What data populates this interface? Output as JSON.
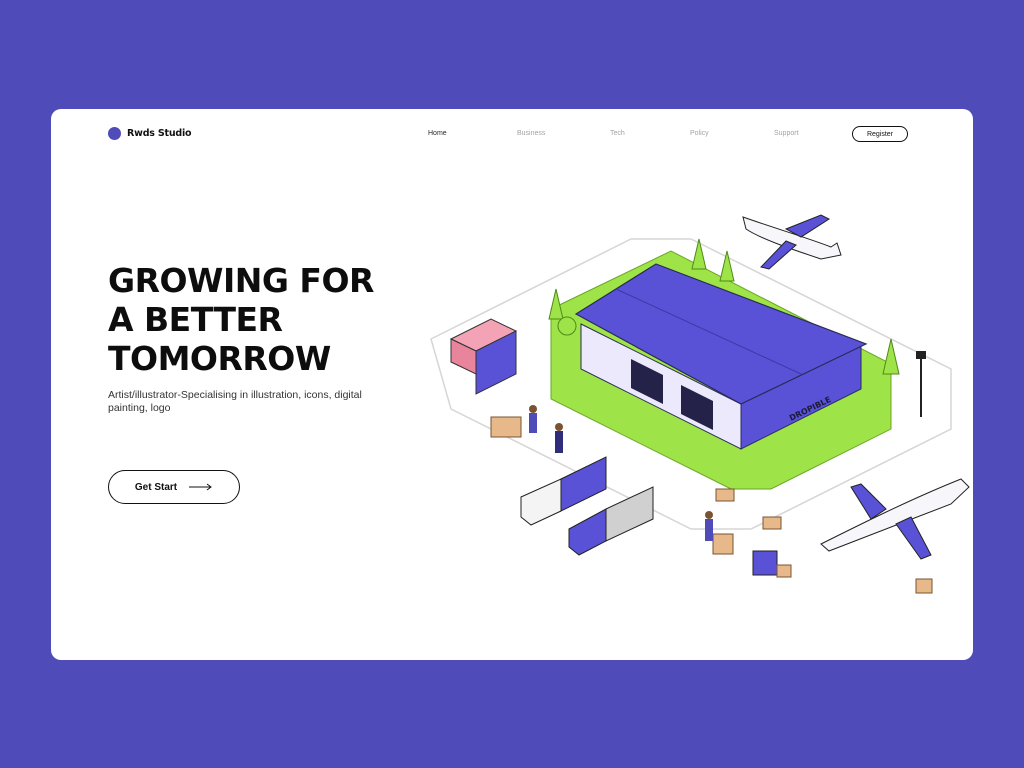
{
  "brand": {
    "name": "Rwds Studio",
    "accent": "#4f4bb8"
  },
  "nav": {
    "items": [
      {
        "label": "Home",
        "active": true
      },
      {
        "label": "Business",
        "active": false
      },
      {
        "label": "Tech",
        "active": false
      },
      {
        "label": "Policy",
        "active": false
      },
      {
        "label": "Support",
        "active": false
      }
    ],
    "register_label": "Register"
  },
  "hero": {
    "headline_lines": [
      "GROWING FOR",
      "A BETTER",
      "TOMORROW"
    ],
    "subtitle": "Artist/illustrator-Specialising in illustration, icons, digital painting, logo",
    "cta_label": "Get Start",
    "cta_icon": "arrow-right-icon"
  },
  "illustration": {
    "warehouse_sign": "DROPIBLE",
    "colors": {
      "roof": "#5a52d6",
      "grass": "#9ee347",
      "background": "#4f4bb8"
    }
  }
}
